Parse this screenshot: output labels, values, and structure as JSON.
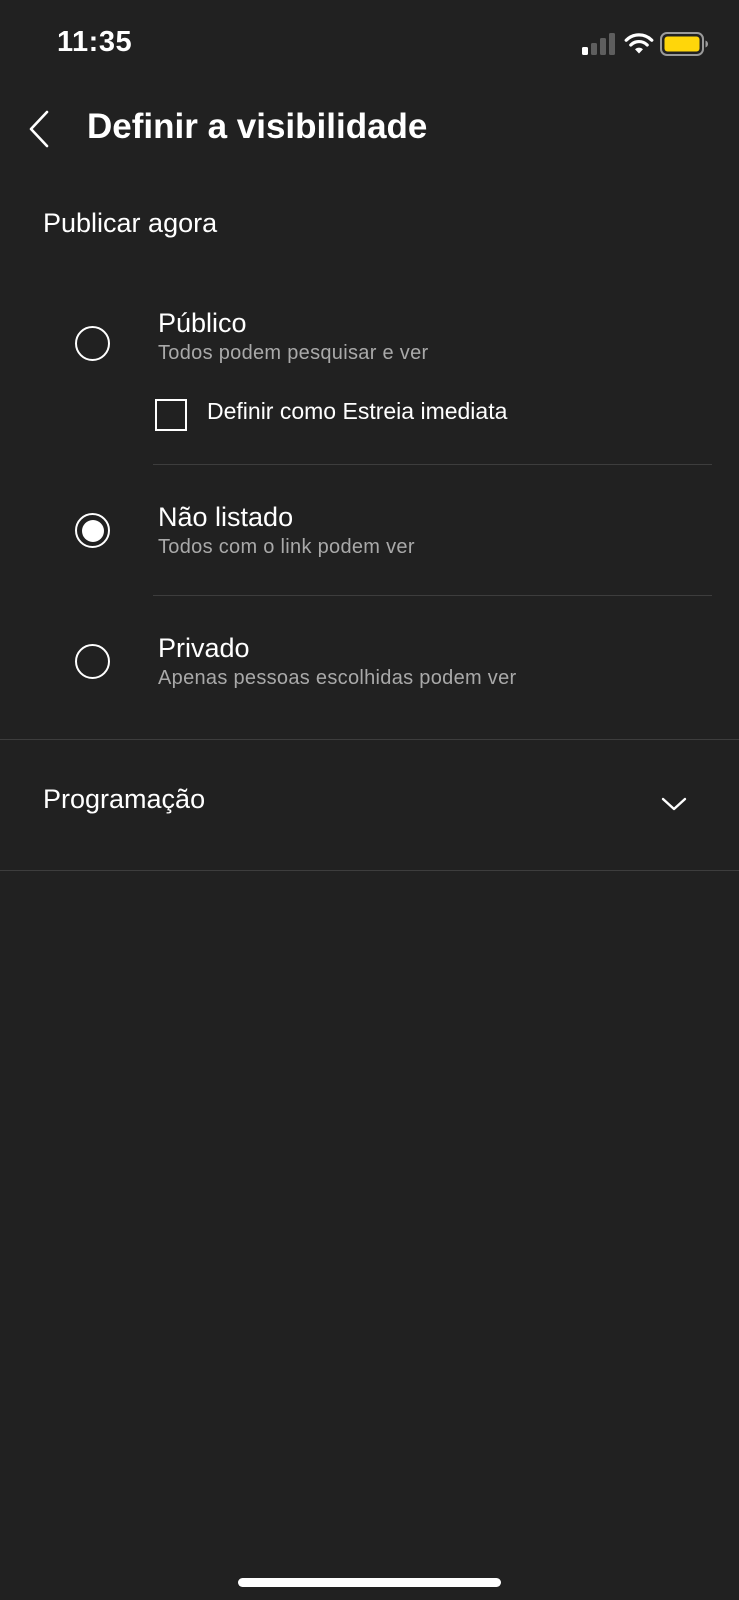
{
  "status_bar": {
    "time": "11:35",
    "battery_color": "#ffd60a"
  },
  "header": {
    "title": "Definir a visibilidade",
    "back_icon": "chevron-left-icon"
  },
  "publish_section": {
    "heading": "Publicar agora",
    "options": [
      {
        "title": "Público",
        "description": "Todos podem pesquisar e ver",
        "selected": false
      },
      {
        "title": "Não listado",
        "description": "Todos com o link podem ver",
        "selected": true
      },
      {
        "title": "Privado",
        "description": "Apenas pessoas escolhidas podem ver",
        "selected": false
      }
    ],
    "premiere_checkbox": {
      "label": "Definir como Estreia imediata",
      "checked": false
    }
  },
  "schedule_section": {
    "label": "Programação",
    "icon": "chevron-down-icon"
  }
}
